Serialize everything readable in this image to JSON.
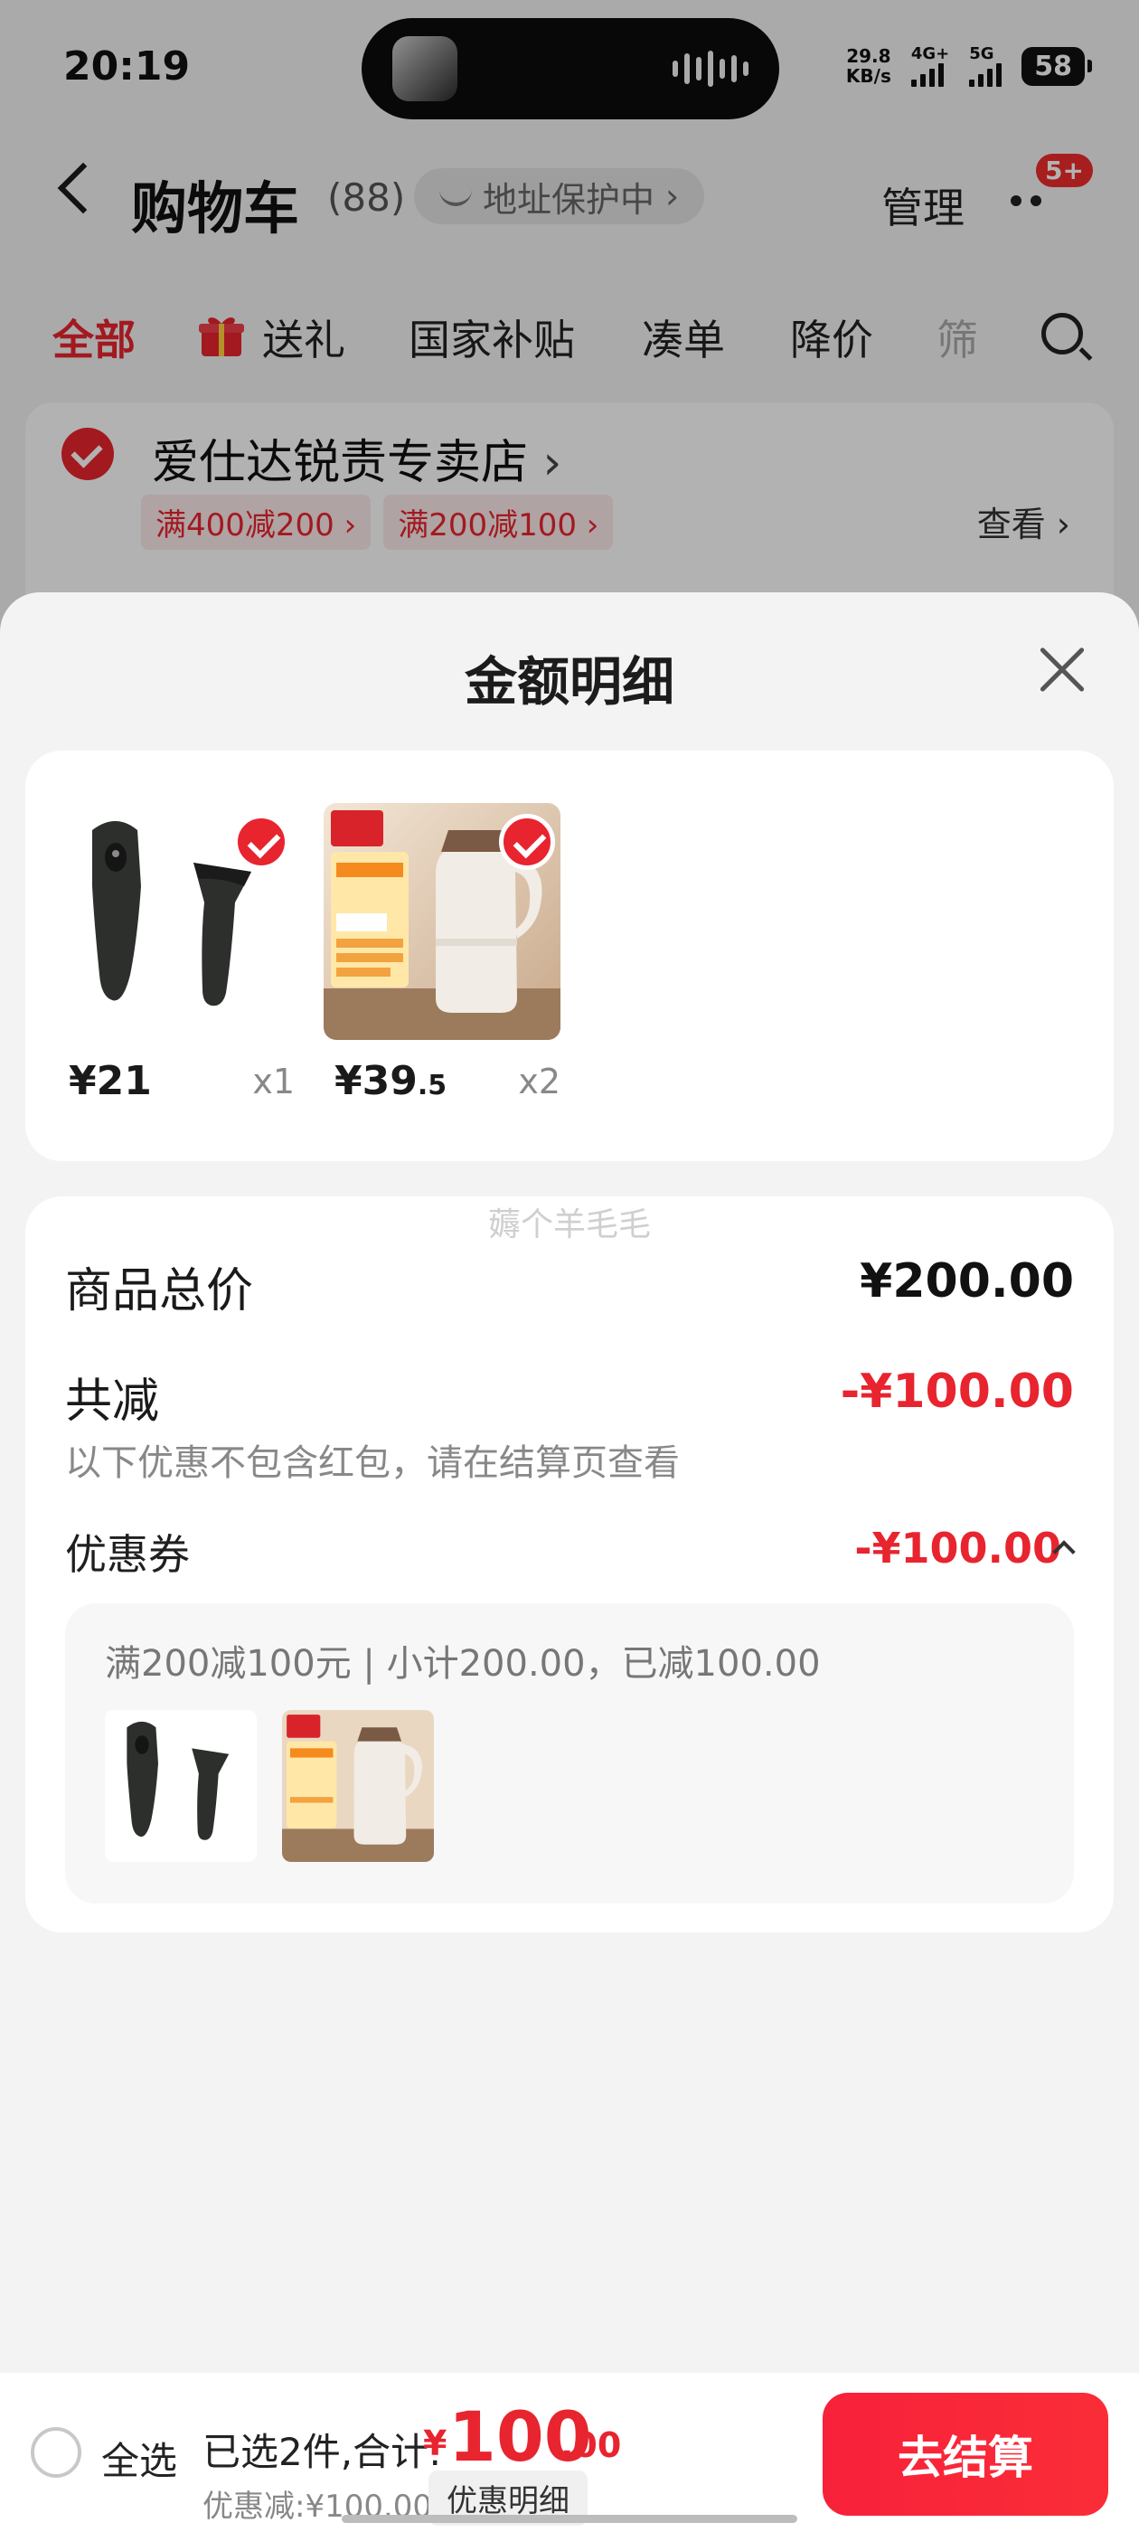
{
  "status_bar": {
    "time": "20:19",
    "net_speed_value": "29.8",
    "net_speed_unit": "KB/s",
    "signal_1": "4G+",
    "signal_2": "5G",
    "battery": "58"
  },
  "header": {
    "title": "购物车",
    "count": "(88)",
    "address_pill": "地址保护中",
    "manage": "管理",
    "message_badge": "5+"
  },
  "tabs": [
    {
      "label": "全部",
      "active": true
    },
    {
      "label": "送礼",
      "icon": "gift-icon"
    },
    {
      "label": "国家补贴"
    },
    {
      "label": "凑单"
    },
    {
      "label": "降价"
    },
    {
      "label": "筛"
    }
  ],
  "store": {
    "name": "爱仕达锐责专卖店",
    "promos": [
      "满400减200",
      "满200减100"
    ],
    "view": "查看"
  },
  "sheet": {
    "title": "金额明细",
    "items": [
      {
        "price_int": "¥21",
        "price_dec": "",
        "qty": "x1",
        "image": "black-iron-handle-product",
        "checked": true
      },
      {
        "price_int": "¥39",
        "price_dec": ".5",
        "qty": "x2",
        "image": "white-thermos-pot-product",
        "checked": true
      }
    ],
    "watermark": "薅个羊毛毛",
    "total_label": "商品总价",
    "total_value": "¥200.00",
    "reduce_label": "共减",
    "reduce_value": "-¥100.00",
    "reduce_note": "以下优惠不包含红包，请在结算页查看",
    "coupon_label": "优惠券",
    "coupon_value": "-¥100.00",
    "coupon_desc": "满200减100元 | 小计200.00，已减100.00"
  },
  "bottom_bar": {
    "select_all": "全选",
    "selected_text": "已选2件,合计:",
    "total_yen": "¥",
    "total_int": "100",
    "total_dec": ".00",
    "discount_note": "优惠减:¥100.00",
    "detail_button": "优惠明细",
    "checkout_button": "去结算"
  },
  "colors": {
    "accent_red": "#e8242f",
    "checkout_red": "#f8213a"
  }
}
